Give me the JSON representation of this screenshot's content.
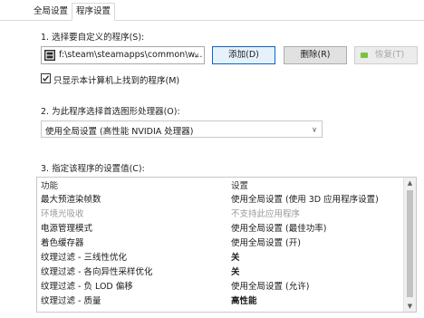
{
  "tabs": [
    {
      "label": "全局设置"
    },
    {
      "label": "程序设置"
    }
  ],
  "section1": {
    "label": "1. 选择要自定义的程序(S):"
  },
  "program": {
    "path": "f:\\steam\\steamapps\\common\\w...",
    "icon": "steam-game-icon"
  },
  "buttons": {
    "add": "添加(D)",
    "remove": "删除(R)",
    "restore": "恢复(T)"
  },
  "checkbox": {
    "label": "只显示本计算机上找到的程序(M)",
    "checked": true
  },
  "section2": {
    "label": "2. 为此程序选择首选图形处理器(O):",
    "value": "使用全局设置 (高性能 NVIDIA 处理器)"
  },
  "section3": {
    "label": "3. 指定该程序的设置值(C):"
  },
  "table": {
    "headers": {
      "feature": "功能",
      "setting": "设置"
    },
    "rows": [
      {
        "feature": "最大预渲染帧数",
        "setting": "使用全局设置 (使用 3D 应用程序设置)",
        "muted": false
      },
      {
        "feature": "环境光吸收",
        "setting": "不支持此应用程序",
        "muted": true
      },
      {
        "feature": "电源管理模式",
        "setting": "使用全局设置 (最佳功率)",
        "muted": false
      },
      {
        "feature": "着色缓存器",
        "setting": "使用全局设置 (开)",
        "muted": false
      },
      {
        "feature": "纹理过滤 - 三线性优化",
        "setting": "关",
        "muted": false
      },
      {
        "feature": "纹理过滤 - 各向异性采样优化",
        "setting": "关",
        "muted": false
      },
      {
        "feature": "纹理过滤 - 负 LOD 偏移",
        "setting": "使用全局设置 (允许)",
        "muted": false
      },
      {
        "feature": "纹理过滤 - 质量",
        "setting": "高性能",
        "muted": false
      }
    ]
  },
  "colors": {
    "accent": "#0a64c8",
    "restore_icon": "#7bc142"
  }
}
